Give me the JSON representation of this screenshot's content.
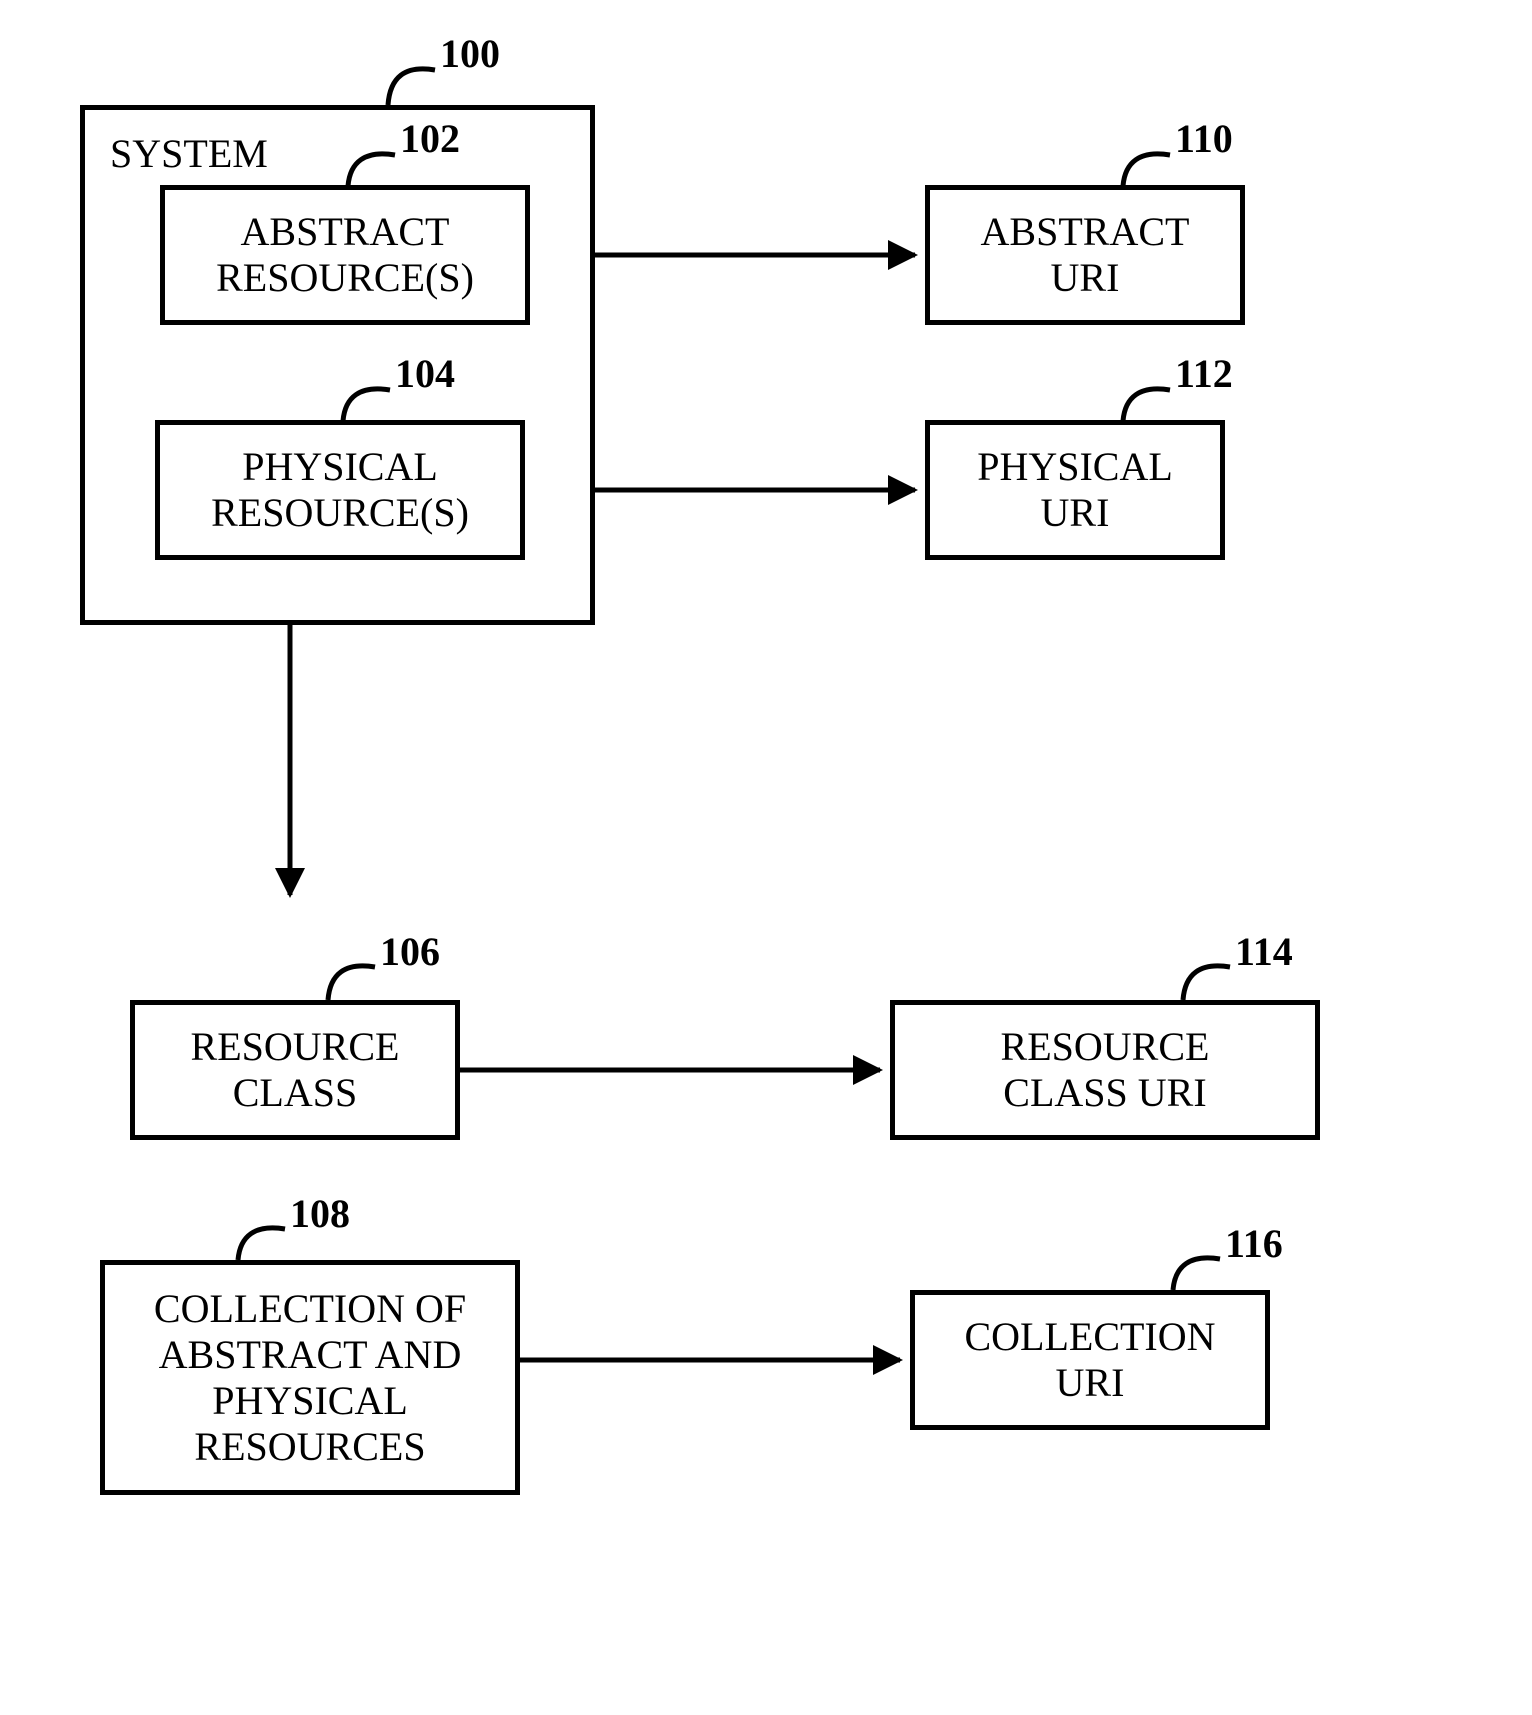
{
  "blocks": {
    "system_label": "SYSTEM",
    "abstract_resources": "ABSTRACT\nRESOURCE(S)",
    "physical_resources": "PHYSICAL\nRESOURCE(S)",
    "resource_class": "RESOURCE\nCLASS",
    "collection": "COLLECTION OF\nABSTRACT AND\nPHYSICAL\nRESOURCES",
    "abstract_uri": "ABSTRACT\nURI",
    "physical_uri": "PHYSICAL\nURI",
    "resource_class_uri": "RESOURCE\nCLASS URI",
    "collection_uri": "COLLECTION\nURI"
  },
  "refs": {
    "n100": "100",
    "n102": "102",
    "n104": "104",
    "n106": "106",
    "n108": "108",
    "n110": "110",
    "n112": "112",
    "n114": "114",
    "n116": "116"
  }
}
